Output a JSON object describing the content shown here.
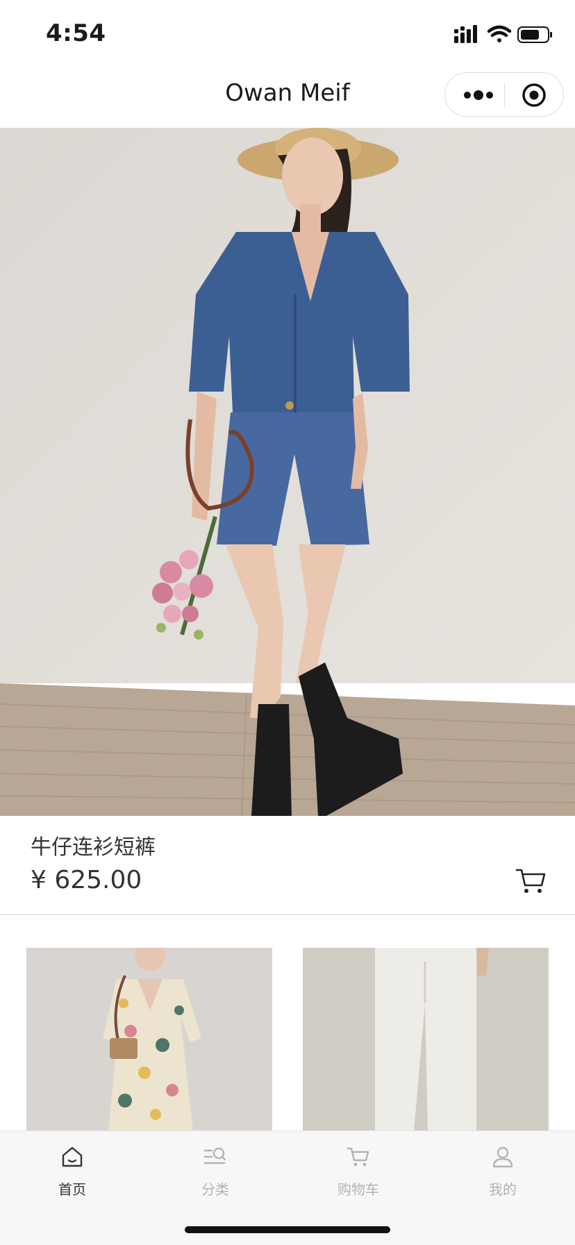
{
  "status_bar": {
    "time": "4:54"
  },
  "header": {
    "title": "Owan Meif"
  },
  "capsule": {
    "more_icon": "more-dots-icon",
    "close_icon": "target-circle-icon"
  },
  "product": {
    "name": "牛仔连衫短裤",
    "price": "¥ 625.00",
    "cart_icon": "shopping-cart-icon"
  },
  "grid": [
    {
      "name": "floral-dress-product"
    },
    {
      "name": "white-trousers-product"
    }
  ],
  "tabs": [
    {
      "label": "首页",
      "icon": "home-icon",
      "active": true
    },
    {
      "label": "分类",
      "icon": "category-search-icon",
      "active": false
    },
    {
      "label": "购物车",
      "icon": "cart-icon",
      "active": false
    },
    {
      "label": "我的",
      "icon": "user-icon",
      "active": false
    }
  ],
  "colors": {
    "active": "#333333",
    "inactive": "#b3b3b3",
    "tabbar_bg": "#f7f7f7"
  }
}
